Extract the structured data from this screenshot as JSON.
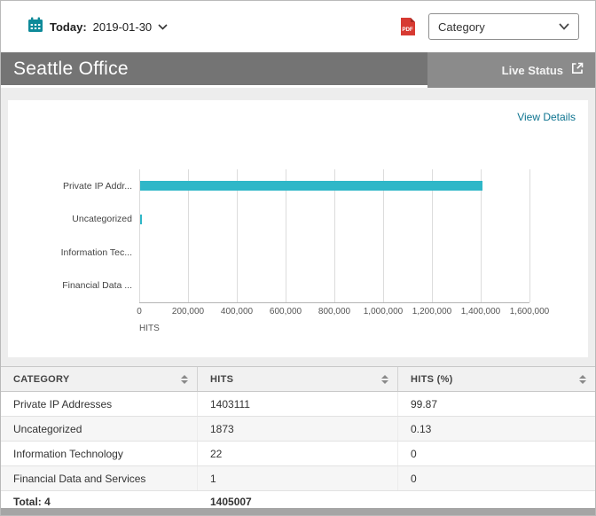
{
  "colors": {
    "teal": "#2fb7c8",
    "link": "#0e7490",
    "title_block_gray": "#747474",
    "header_gray": "#8b8b8b",
    "pdf_red": "#d73a32",
    "calendar_teal": "#0e8a99"
  },
  "topbar": {
    "today_label": "Today:",
    "date": "2019-01-30",
    "pdf_icon_label": "PDF",
    "category_dropdown": "Category"
  },
  "header": {
    "title": "Seattle Office",
    "live_status_label": "Live Status"
  },
  "content": {
    "view_details_label": "View Details"
  },
  "chart_data": {
    "type": "bar",
    "orientation": "horizontal",
    "categories": [
      "Private IP Addr...",
      "Uncategorized",
      "Information Tec...",
      "Financial Data ..."
    ],
    "values": [
      1403111,
      1873,
      22,
      1
    ],
    "xlabel": "HITS",
    "xlim": [
      0,
      1600000
    ],
    "xticks": [
      0,
      200000,
      400000,
      600000,
      800000,
      1000000,
      1200000,
      1400000,
      1600000
    ],
    "xtick_labels": [
      "0",
      "200,000",
      "400,000",
      "600,000",
      "800,000",
      "1,000,000",
      "1,200,000",
      "1,400,000",
      "1,600,000"
    ],
    "bar_color": "#2fb7c8",
    "grid": true,
    "legend": false
  },
  "table": {
    "columns": [
      {
        "label": "CATEGORY",
        "sortable": true
      },
      {
        "label": "HITS",
        "sortable": true
      },
      {
        "label": "HITS (%)",
        "sortable": true
      }
    ],
    "rows": [
      {
        "category": "Private IP Addresses",
        "hits": "1403111",
        "hits_pct": "99.87"
      },
      {
        "category": "Uncategorized",
        "hits": "1873",
        "hits_pct": "0.13"
      },
      {
        "category": "Information Technology",
        "hits": "22",
        "hits_pct": "0"
      },
      {
        "category": "Financial Data and Services",
        "hits": "1",
        "hits_pct": "0"
      }
    ],
    "total": {
      "label": "Total: 4",
      "hits": "1405007",
      "hits_pct": ""
    }
  }
}
